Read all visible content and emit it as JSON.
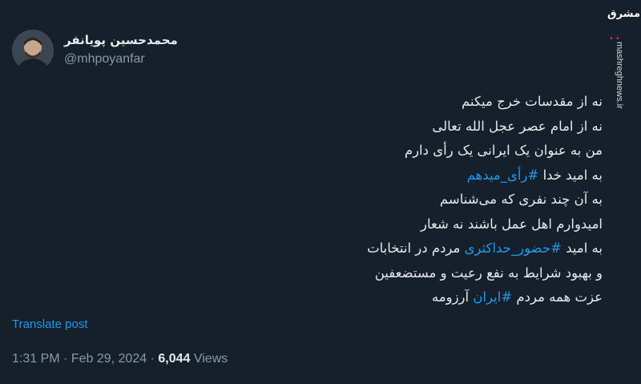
{
  "author": {
    "display_name": "محمدحسین پویانفر",
    "handle": "@mhpoyanfar"
  },
  "watermark": {
    "logo_text": "مشرق",
    "site": "mashreghnews.ir"
  },
  "tweet": {
    "lines": [
      "نه از مقدسات خرج میکنم",
      "نه از امام عصر عجل الله تعالی",
      "من به عنوان یک ایرانی یک رأی دارم",
      "به امید خدا",
      "به آن چند نفری که می‌شناسم",
      "امیدوارم اهل عمل باشند نه شعار",
      "به امید",
      "مردم در انتخابات",
      "و بهبود شرایط به نفع رعیت و مستضعفین",
      "عزت همه مردم",
      "آرزومه"
    ],
    "hashtags": [
      "#رأی_میدهم",
      "#حضور_حداکثری",
      "#ایران"
    ]
  },
  "translate_label": "Translate post",
  "meta": {
    "time": "1:31 PM",
    "date": "Feb 29, 2024",
    "separator": "·",
    "views_count": "6,044",
    "views_label": "Views"
  },
  "colors": {
    "background": "#15202b",
    "text": "#e7e9ea",
    "secondary": "#8b98a5",
    "accent": "#1d9bf0"
  }
}
